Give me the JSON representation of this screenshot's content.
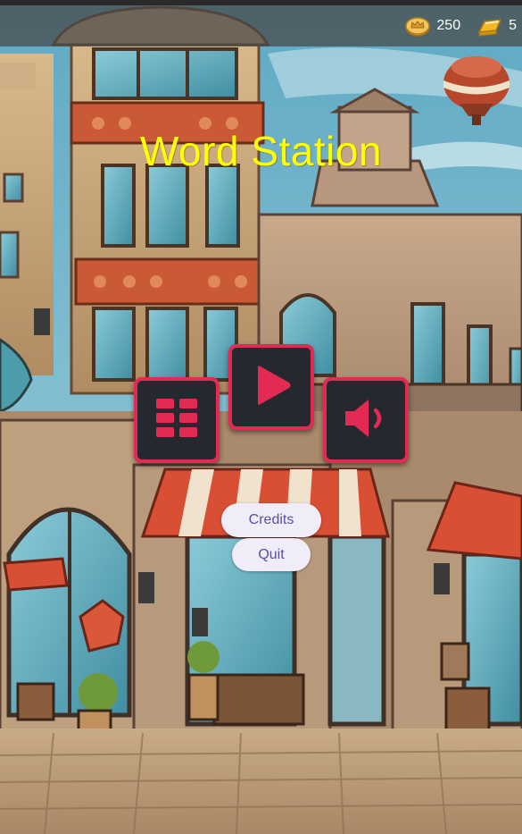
{
  "app": {
    "title": "Word Station"
  },
  "currencies": [
    {
      "icon": "crown-coin-icon",
      "value": "250"
    },
    {
      "icon": "gold-bar-icon",
      "value": "5"
    }
  ],
  "buttons": {
    "levels_icon": "grid-icon",
    "play_icon": "play-icon",
    "sound_icon": "speaker-icon",
    "credits_label": "Credits",
    "quit_label": "Quit"
  },
  "colors": {
    "title": "#ffff00",
    "button_border": "#e22a52",
    "button_fill": "#25292f",
    "pill_bg": "#f1edf8",
    "pill_text": "#5b4fa0"
  }
}
